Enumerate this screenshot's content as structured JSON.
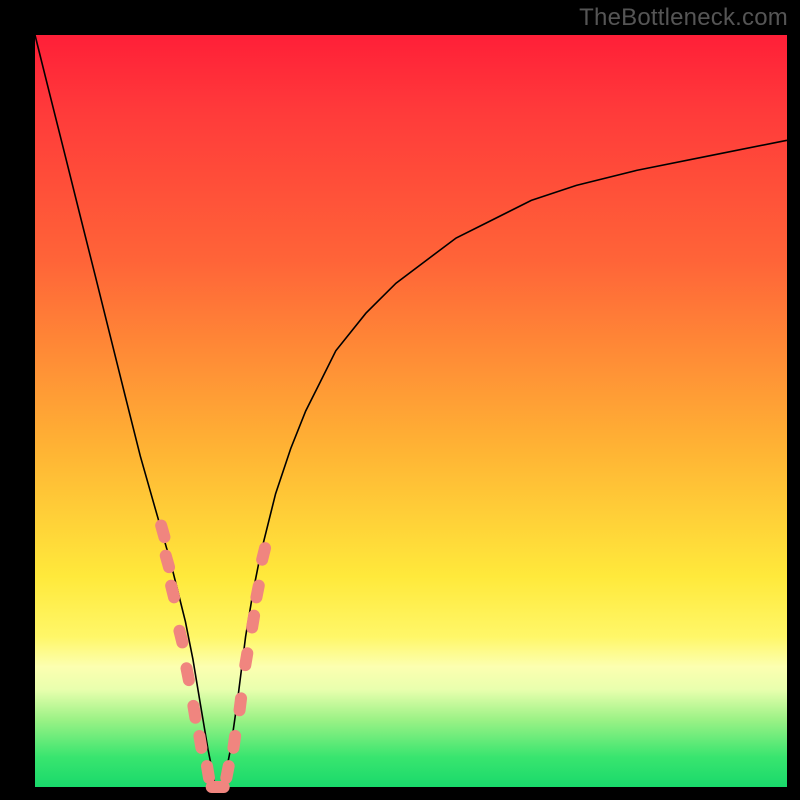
{
  "watermark": "TheBottleneck.com",
  "colors": {
    "frame": "#000000",
    "gradient_top": "#ff1f38",
    "gradient_mid": "#ffe93b",
    "gradient_bottom": "#19d96b",
    "curve": "#000000",
    "marker": "#f0857f"
  },
  "chart_data": {
    "type": "line",
    "title": "",
    "xlabel": "",
    "ylabel": "",
    "xlim": [
      0,
      100
    ],
    "ylim": [
      0,
      100
    ],
    "x": [
      0,
      2,
      4,
      6,
      8,
      10,
      12,
      14,
      16,
      18,
      19,
      20,
      21,
      22,
      23,
      24,
      25,
      26,
      27,
      28,
      29,
      30,
      31,
      32,
      34,
      36,
      38,
      40,
      44,
      48,
      52,
      56,
      60,
      66,
      72,
      80,
      90,
      100
    ],
    "values": [
      100,
      92,
      84,
      76,
      68,
      60,
      52,
      44,
      37,
      30,
      26,
      22,
      17,
      11,
      5,
      0,
      0,
      5,
      12,
      20,
      26,
      31,
      35,
      39,
      45,
      50,
      54,
      58,
      63,
      67,
      70,
      73,
      75,
      78,
      80,
      82,
      84,
      86
    ],
    "markers": [
      {
        "x": 17.0,
        "y": 34
      },
      {
        "x": 17.6,
        "y": 30
      },
      {
        "x": 18.3,
        "y": 26
      },
      {
        "x": 19.4,
        "y": 20
      },
      {
        "x": 20.3,
        "y": 15
      },
      {
        "x": 21.2,
        "y": 10
      },
      {
        "x": 22.0,
        "y": 6
      },
      {
        "x": 23.0,
        "y": 2
      },
      {
        "x": 24.3,
        "y": 0
      },
      {
        "x": 25.6,
        "y": 2
      },
      {
        "x": 26.5,
        "y": 6
      },
      {
        "x": 27.3,
        "y": 11
      },
      {
        "x": 28.1,
        "y": 17
      },
      {
        "x": 29.0,
        "y": 22
      },
      {
        "x": 29.6,
        "y": 26
      },
      {
        "x": 30.4,
        "y": 31
      }
    ],
    "legend": [],
    "grid": false
  }
}
